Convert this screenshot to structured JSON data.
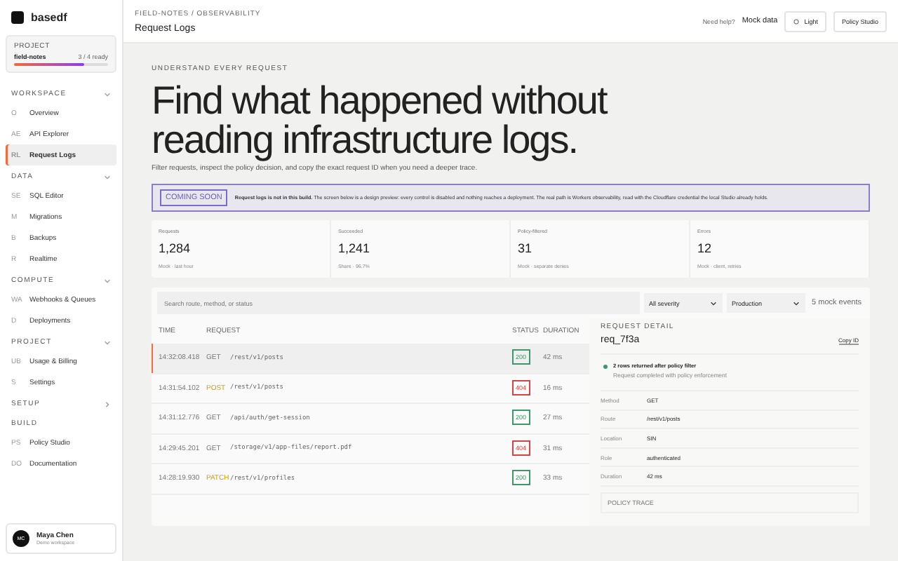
{
  "sidebar": {
    "brand": "basedf",
    "project": {
      "label": "PROJECT",
      "name": "field-notes",
      "status": "3 / 4 ready",
      "level": 0.75
    },
    "sections": [
      {
        "title": "WORKSPACE",
        "expanded": true,
        "items": [
          {
            "abbr": "O",
            "label": "Overview",
            "selected": false
          },
          {
            "abbr": "AE",
            "label": "API Explorer",
            "selected": false
          },
          {
            "abbr": "RL",
            "label": "Request Logs",
            "selected": true
          }
        ]
      },
      {
        "title": "DATA",
        "expanded": true,
        "items": [
          {
            "abbr": "SE",
            "label": "SQL Editor",
            "selected": false
          },
          {
            "abbr": "M",
            "label": "Migrations",
            "selected": false
          },
          {
            "abbr": "B",
            "label": "Backups",
            "selected": false
          },
          {
            "abbr": "R",
            "label": "Realtime",
            "selected": false
          }
        ]
      },
      {
        "title": "COMPUTE",
        "expanded": true,
        "items": [
          {
            "abbr": "WA",
            "label": "Webhooks & Queues",
            "selected": false
          },
          {
            "abbr": "D",
            "label": "Deployments",
            "selected": false
          }
        ]
      },
      {
        "title": "PROJECT",
        "expanded": true,
        "items": [
          {
            "abbr": "UB",
            "label": "Usage & Billing",
            "selected": false
          },
          {
            "abbr": "S",
            "label": "Settings",
            "selected": false
          }
        ]
      },
      {
        "title": "SETUP",
        "expanded": false
      },
      {
        "title": "BUILD",
        "items": [
          {
            "abbr": "PS",
            "label": "Policy Studio",
            "selected": false
          },
          {
            "abbr": "DO",
            "label": "Documentation",
            "selected": false
          }
        ]
      }
    ],
    "user": {
      "initials": "MC",
      "name": "Maya Chen",
      "role": "Demo workspace"
    }
  },
  "header": {
    "breadcrumb": "FIELD-NOTES / OBSERVABILITY",
    "title": "Request Logs",
    "help": "Need help?",
    "mock": "Mock data",
    "theme": "Light",
    "studio": "Policy Studio"
  },
  "hero": {
    "eyebrow": "UNDERSTAND EVERY REQUEST",
    "title": "Find what happened without reading infrastructure logs.",
    "lead": "Filter requests, inspect the policy decision, and copy the exact request ID when you need a deeper trace."
  },
  "banner": {
    "badge": "COMING SOON",
    "text": "**Request logs is not in this build.** The screen below is a design preview: every control is disabled and nothing reaches a deployment. The real path is Workers observability, read with the Cloudflare credential the local Studio already holds."
  },
  "metrics": [
    {
      "label": "Requests",
      "value": "1,284",
      "note": "Mock · last hour"
    },
    {
      "label": "Succeeded",
      "value": "1,241",
      "note": "Share · 96.7%"
    },
    {
      "label": "Policy-filtered",
      "value": "31",
      "note": "Mock · separate denies"
    },
    {
      "label": "Errors",
      "value": "12",
      "note": "Mock · client, retries"
    }
  ],
  "filters": {
    "search": {
      "placeholder": "Search route, method, or status"
    },
    "severity": "All severity",
    "environment": "Production",
    "count": "5 mock events"
  },
  "table": {
    "columns": [
      "TIME",
      "REQUEST",
      "STATUS",
      "DURATION"
    ],
    "rows": [
      {
        "time": "14:32:08.418",
        "method": "GET",
        "path": "/rest/v1/posts",
        "status": "200",
        "duration": "42 ms",
        "selected": true
      },
      {
        "time": "14:31:54.102",
        "method": "POST",
        "path": "/rest/v1/posts",
        "status": "404",
        "duration": "16 ms",
        "selected": false
      },
      {
        "time": "14:31:12.776",
        "method": "GET",
        "path": "/api/auth/get-session",
        "status": "200",
        "duration": "27 ms",
        "selected": false
      },
      {
        "time": "14:29:45.201",
        "method": "GET",
        "path": "/storage/v1/app-files/report.pdf",
        "status": "404",
        "duration": "31 ms",
        "selected": false
      },
      {
        "time": "14:28:19.930",
        "method": "PATCH",
        "path": "/rest/v1/profiles",
        "status": "200",
        "duration": "33 ms",
        "selected": false
      }
    ]
  },
  "detail": {
    "heading": "REQUEST DETAIL",
    "id": "req_7f3a",
    "copy": "Copy ID",
    "result": "2 rows returned after policy filter",
    "result_note": "Request completed with policy enforcement",
    "fields": [
      {
        "label": "Method",
        "value": "GET"
      },
      {
        "label": "Route",
        "value": "/rest/v1/posts"
      },
      {
        "label": "Location",
        "value": "SIN"
      },
      {
        "label": "Role",
        "value": "authenticated"
      },
      {
        "label": "Duration",
        "value": "42 ms"
      }
    ],
    "trace": "POLICY TRACE"
  }
}
